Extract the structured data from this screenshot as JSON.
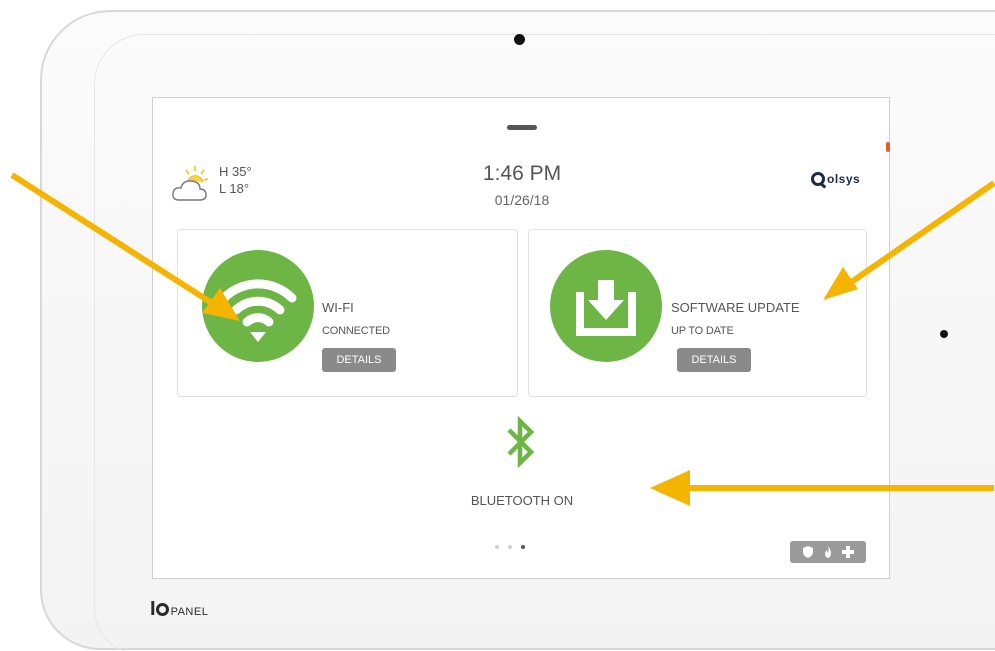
{
  "weather": {
    "high": "H 35°",
    "low": "L 18°",
    "icon": "partly-cloudy-icon"
  },
  "clock": {
    "time": "1:46 PM",
    "date": "01/26/18"
  },
  "brand": {
    "name": "olsys"
  },
  "cards": {
    "wifi": {
      "title": "WI-FI",
      "status": "CONNECTED",
      "button": "DETAILS",
      "icon": "wifi-icon"
    },
    "update": {
      "title": "SOFTWARE UPDATE",
      "status": "UP TO DATE",
      "button": "DETAILS",
      "icon": "download-icon"
    }
  },
  "bluetooth": {
    "label": "BLUETOOTH ON",
    "icon": "bluetooth-icon"
  },
  "pager": {
    "pages": 3,
    "active": 3
  },
  "quick_actions": {
    "icons": [
      "shield-icon",
      "flame-icon",
      "plus-icon"
    ]
  },
  "product": {
    "iq": "I",
    "name": "PANEL"
  },
  "colors": {
    "accent_green": "#6db545",
    "arrow_orange": "#f5b400",
    "button_gray": "#8a8a8a",
    "brand_navy": "#1a2a4a"
  }
}
